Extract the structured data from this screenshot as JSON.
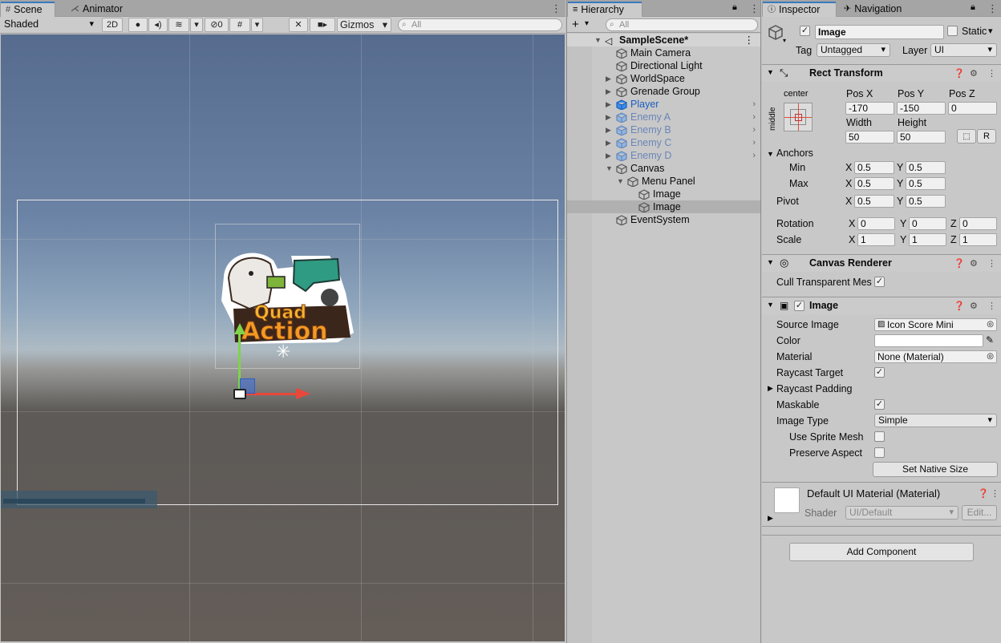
{
  "scene": {
    "tabs": [
      {
        "label": "Scene",
        "icon": "grid-icon"
      },
      {
        "label": "Animator",
        "icon": "animator-icon"
      }
    ],
    "toolbar": {
      "shading_mode": "Shaded",
      "btn_2d": "2D",
      "hidden_count": "0",
      "gizmos_label": "Gizmos",
      "search_placeholder": "All"
    }
  },
  "hierarchy": {
    "tab_label": "Hierarchy",
    "search_placeholder": "All",
    "scene_name": "SampleScene*",
    "items": [
      {
        "label": "Main Camera",
        "depth": 1,
        "arrow": "",
        "type": "normal"
      },
      {
        "label": "Directional Light",
        "depth": 1,
        "arrow": "",
        "type": "normal"
      },
      {
        "label": "WorldSpace",
        "depth": 1,
        "arrow": "collapsed",
        "type": "normal"
      },
      {
        "label": "Grenade Group",
        "depth": 1,
        "arrow": "collapsed",
        "type": "normal"
      },
      {
        "label": "Player",
        "depth": 1,
        "arrow": "collapsed",
        "type": "prefab-strong"
      },
      {
        "label": "Enemy A",
        "depth": 1,
        "arrow": "collapsed",
        "type": "prefab"
      },
      {
        "label": "Enemy B",
        "depth": 1,
        "arrow": "collapsed",
        "type": "prefab"
      },
      {
        "label": "Enemy C",
        "depth": 1,
        "arrow": "collapsed",
        "type": "prefab"
      },
      {
        "label": "Enemy D",
        "depth": 1,
        "arrow": "collapsed",
        "type": "prefab"
      },
      {
        "label": "Canvas",
        "depth": 1,
        "arrow": "expanded",
        "type": "normal"
      },
      {
        "label": "Menu Panel",
        "depth": 2,
        "arrow": "expanded",
        "type": "normal"
      },
      {
        "label": "Image",
        "depth": 3,
        "arrow": "",
        "type": "normal"
      },
      {
        "label": "Image",
        "depth": 3,
        "arrow": "",
        "type": "selected"
      },
      {
        "label": "EventSystem",
        "depth": 1,
        "arrow": "",
        "type": "normal"
      }
    ]
  },
  "inspector": {
    "tabs": [
      {
        "label": "Inspector"
      },
      {
        "label": "Navigation"
      }
    ],
    "object_name": "Image",
    "static_label": "Static",
    "tag_label": "Tag",
    "tag_value": "Untagged",
    "layer_label": "Layer",
    "layer_value": "UI",
    "rect_transform": {
      "title": "Rect Transform",
      "anchor_h": "center",
      "anchor_v": "middle",
      "pos_x_label": "Pos X",
      "pos_y_label": "Pos Y",
      "pos_z_label": "Pos Z",
      "pos_x": "-170",
      "pos_y": "-150",
      "pos_z": "0",
      "width_label": "Width",
      "height_label": "Height",
      "width": "50",
      "height": "50",
      "r_button": "R",
      "anchors_label": "Anchors",
      "min_label": "Min",
      "max_label": "Max",
      "min_x": "0.5",
      "min_y": "0.5",
      "max_x": "0.5",
      "max_y": "0.5",
      "pivot_label": "Pivot",
      "pivot_x": "0.5",
      "pivot_y": "0.5",
      "rotation_label": "Rotation",
      "rot_x": "0",
      "rot_y": "0",
      "rot_z": "0",
      "scale_label": "Scale",
      "scale_x": "1",
      "scale_y": "1",
      "scale_z": "1",
      "x": "X",
      "y": "Y",
      "z": "Z"
    },
    "canvas_renderer": {
      "title": "Canvas Renderer",
      "cull_label": "Cull Transparent Mes"
    },
    "image": {
      "title": "Image",
      "source_image_label": "Source Image",
      "source_image_value": "Icon Score Mini",
      "color_label": "Color",
      "material_label": "Material",
      "material_value": "None (Material)",
      "raycast_target_label": "Raycast Target",
      "raycast_padding_label": "Raycast Padding",
      "maskable_label": "Maskable",
      "image_type_label": "Image Type",
      "image_type_value": "Simple",
      "use_sprite_mesh_label": "Use Sprite Mesh",
      "preserve_aspect_label": "Preserve Aspect",
      "set_native_size": "Set Native Size"
    },
    "material_preview": {
      "title": "Default UI Material (Material)",
      "shader_label": "Shader",
      "shader_value": "UI/Default",
      "edit_button": "Edit..."
    },
    "add_component": "Add Component"
  },
  "logo": {
    "line1": "Quad",
    "line2": "Action"
  },
  "colors": {
    "accent": "#3a79bb",
    "selection": "#b0b0b0",
    "prefab_blue": "#1a5dc0",
    "prefab_light": "#6a86b8"
  }
}
